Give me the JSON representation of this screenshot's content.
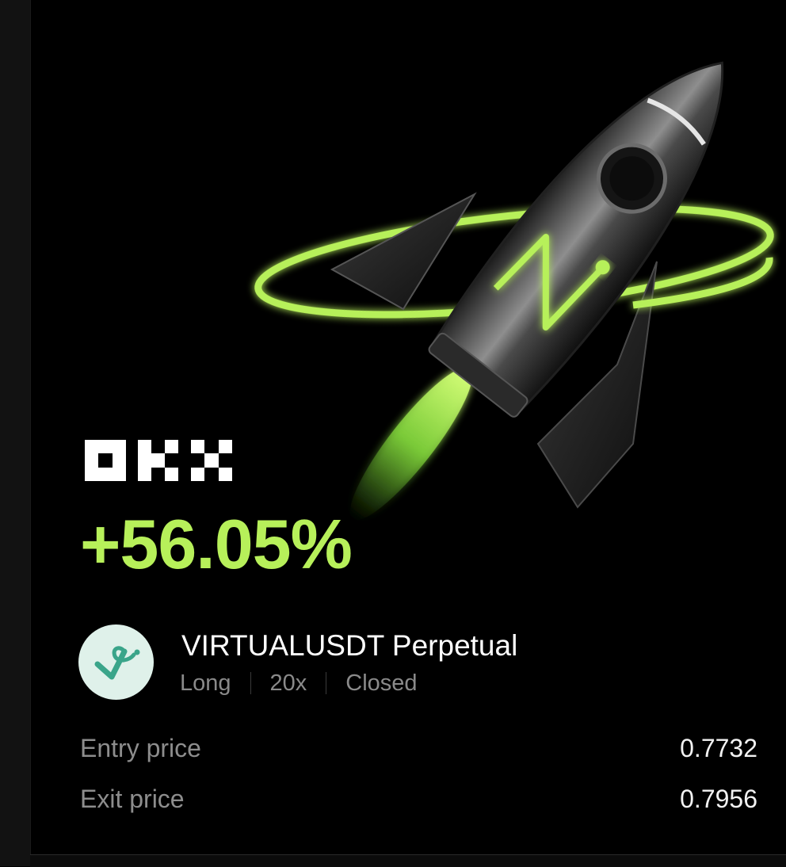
{
  "brand": {
    "logo_text": "OKX",
    "logo_icon": "okx-logo-icon",
    "accent_color": "#b7f05a"
  },
  "hero": {
    "image": "rocket-illustration-icon"
  },
  "pnl": {
    "value": "+56.05%"
  },
  "position": {
    "token_icon": "virtual-token-icon",
    "title": "VIRTUALUSDT Perpetual",
    "direction": "Long",
    "leverage": "20x",
    "status": "Closed"
  },
  "prices": {
    "entry_label": "Entry price",
    "entry_value": "0.7732",
    "exit_label": "Exit price",
    "exit_value": "0.7956"
  }
}
